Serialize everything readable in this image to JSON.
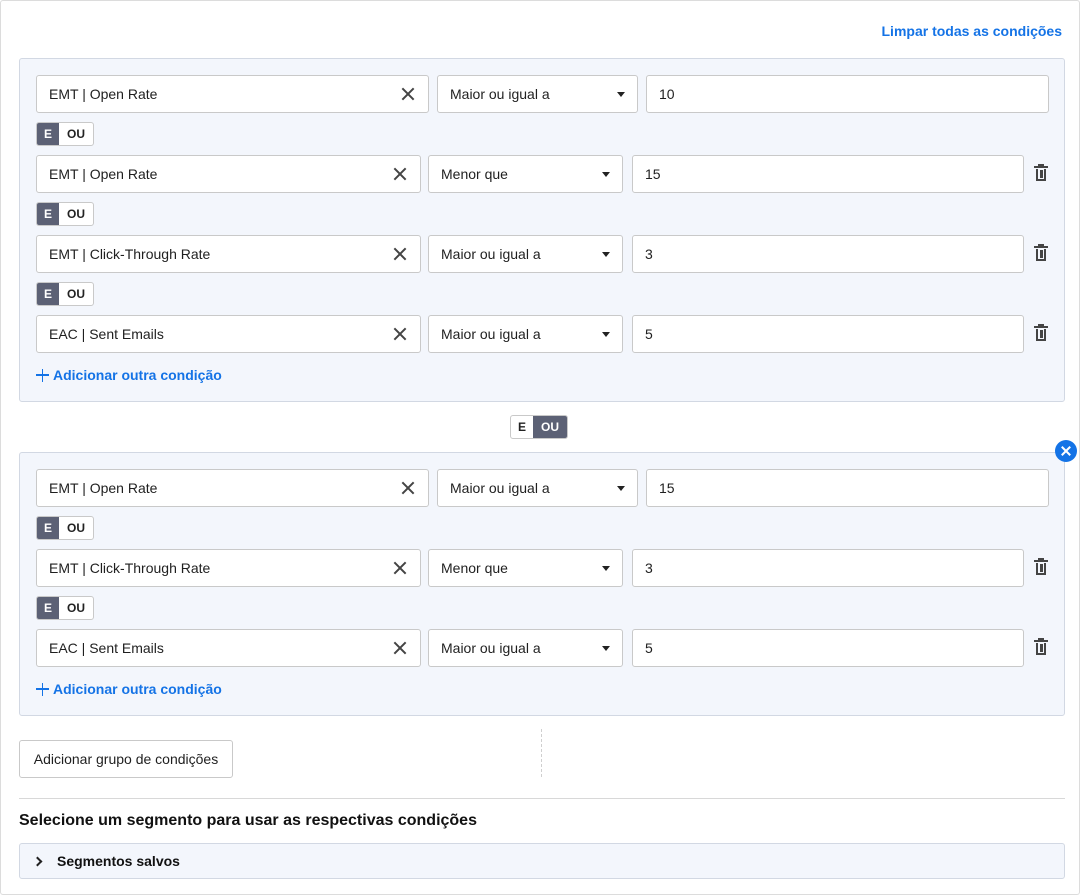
{
  "clear_all_label": "Limpar todas as condições",
  "toggle": {
    "and_label": "E",
    "or_label": "OU"
  },
  "group1": {
    "conditions": [
      {
        "field": "EMT | Open Rate",
        "operator": "Maior ou igual a",
        "value": "10"
      },
      {
        "field": "EMT | Open Rate",
        "operator": "Menor que",
        "value": "15"
      },
      {
        "field": "EMT | Click-Through Rate",
        "operator": "Maior ou igual a",
        "value": "3"
      },
      {
        "field": "EAC | Sent Emails",
        "operator": "Maior ou igual a",
        "value": "5"
      }
    ],
    "connector": "E",
    "add_condition_label": "Adicionar outra condição"
  },
  "between_groups_connector": "OU",
  "group2": {
    "conditions": [
      {
        "field": "EMT | Open Rate",
        "operator": "Maior ou igual a",
        "value": "15"
      },
      {
        "field": "EMT | Click-Through Rate",
        "operator": "Menor que",
        "value": "3"
      },
      {
        "field": "EAC | Sent Emails",
        "operator": "Maior ou igual a",
        "value": "5"
      }
    ],
    "connector": "E",
    "add_condition_label": "Adicionar outra condição"
  },
  "add_group_label": "Adicionar grupo de condições",
  "segment_section_title": "Selecione um segmento para usar as respectivas condições",
  "saved_segments_label": "Segmentos salvos",
  "colors": {
    "accent": "#1473e6",
    "toggle_active": "#5c6175",
    "group_bg": "#f3f6fc"
  }
}
